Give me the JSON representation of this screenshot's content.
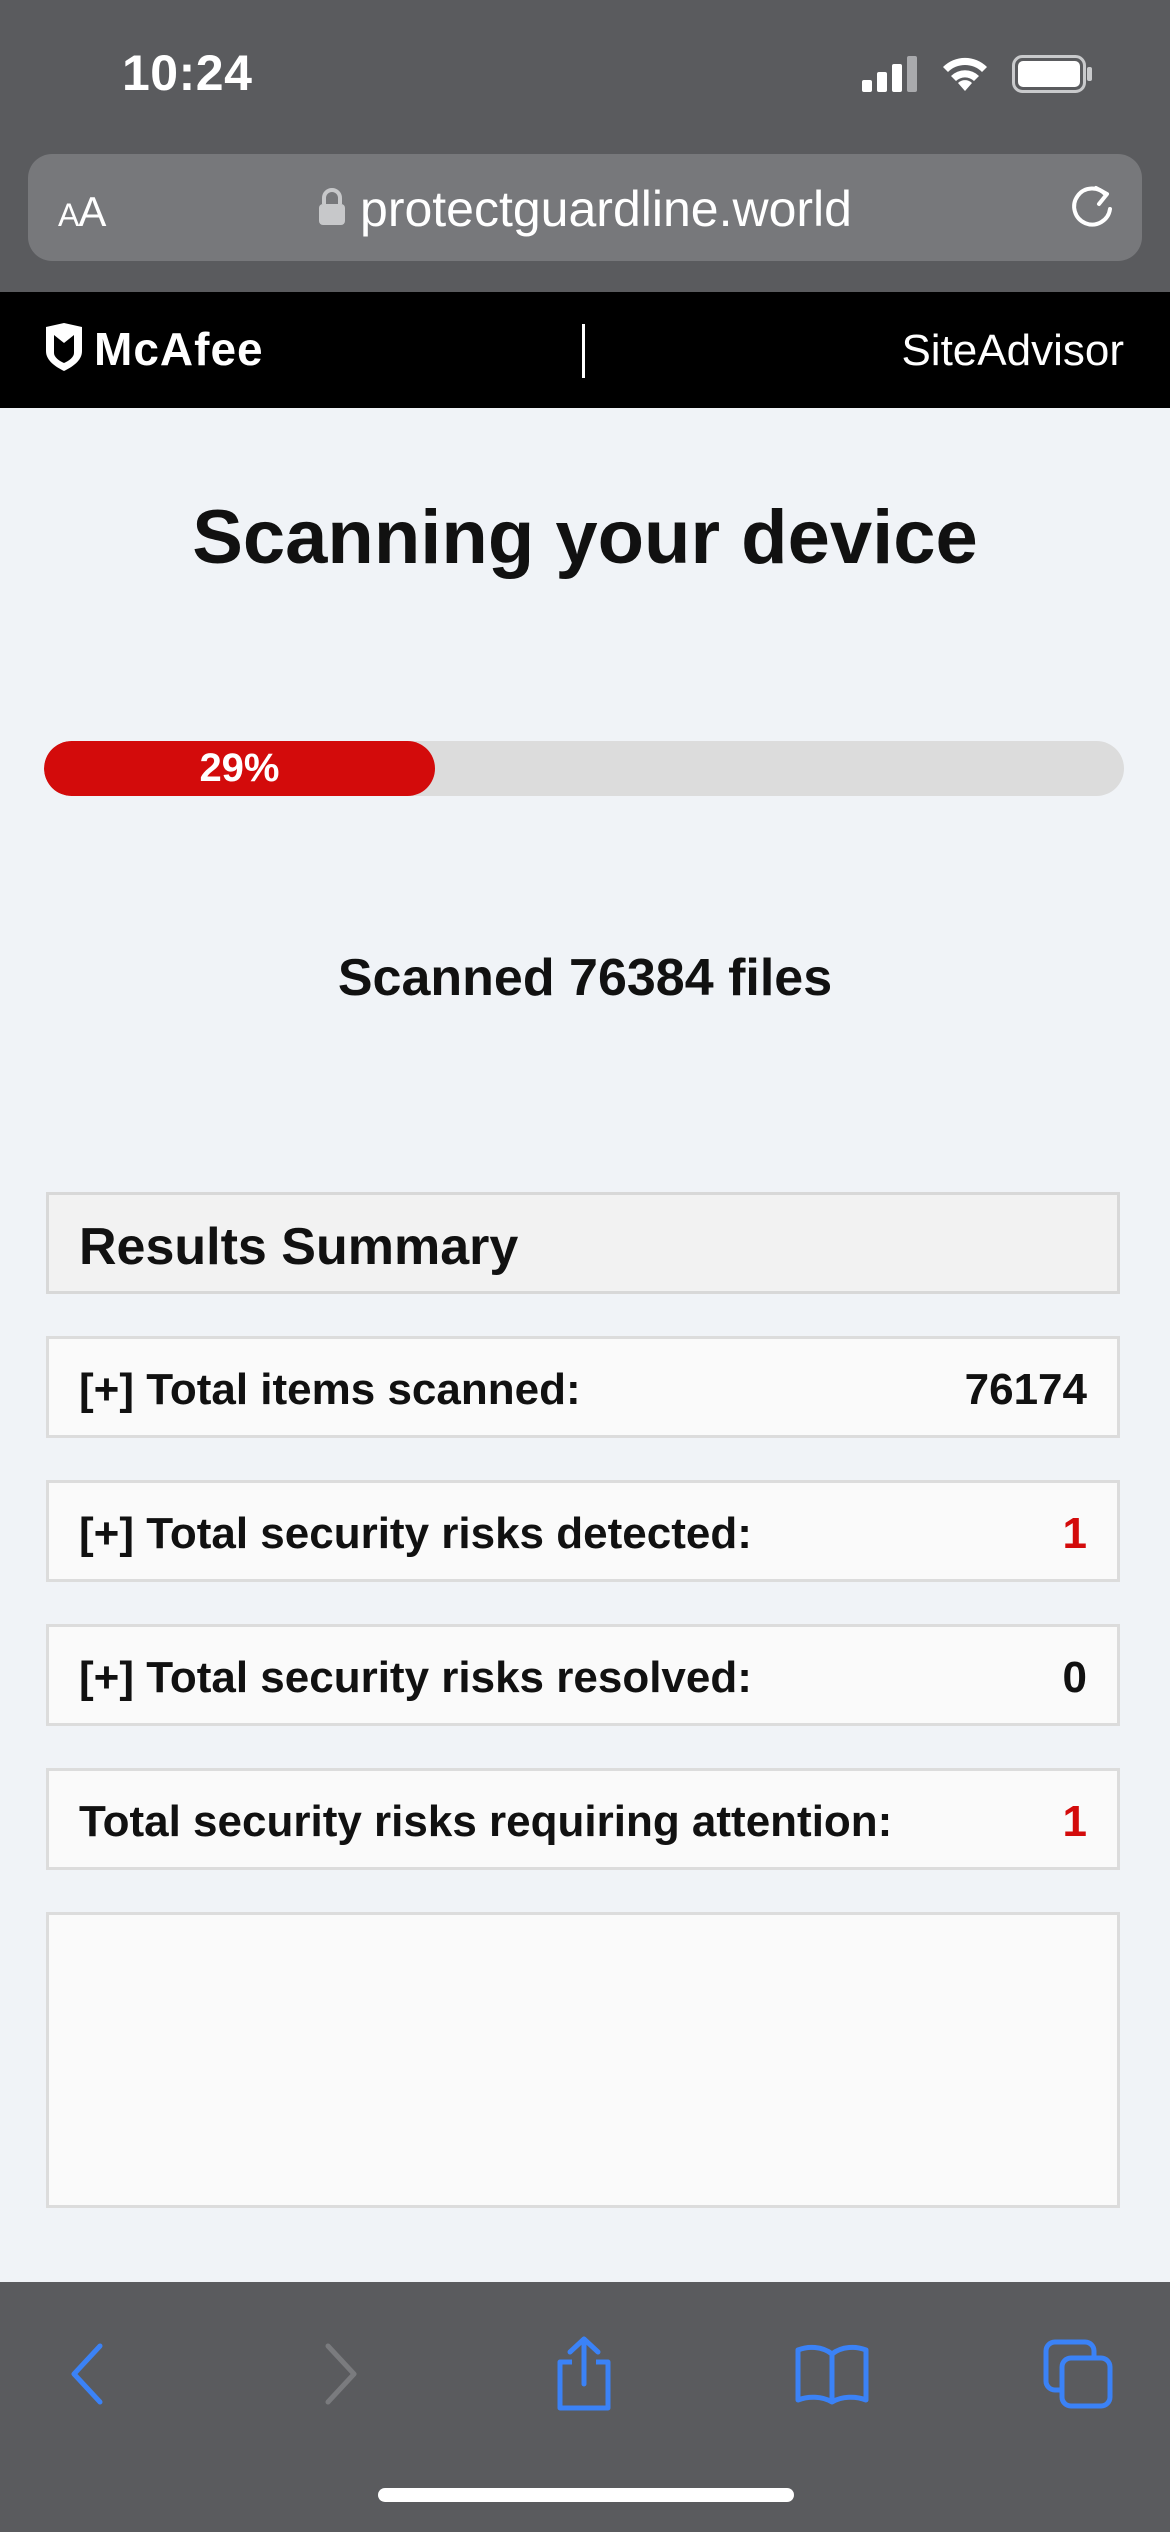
{
  "status_bar": {
    "time": "10:24",
    "icons": [
      "signal-icon",
      "wifi-icon",
      "battery-icon"
    ]
  },
  "browser": {
    "text_size_label_small": "A",
    "text_size_label_large": "A",
    "url": "protectguardline.world",
    "url_icons": [
      "lock-icon",
      "reload-icon"
    ],
    "toolbar_icons": [
      "back-icon",
      "forward-icon",
      "share-icon",
      "bookmarks-icon",
      "tabs-icon"
    ]
  },
  "header": {
    "brand": "McAfee",
    "product": "SiteAdvisor"
  },
  "scan": {
    "title": "Scanning your device",
    "progress_label": "29%",
    "progress_fraction": 0.362,
    "scanned_text": "Scanned 76384 files"
  },
  "results": {
    "title": "Results Summary",
    "rows": [
      {
        "label": "[+] Total items scanned:",
        "value": "76174",
        "highlight": false
      },
      {
        "label": "[+] Total security risks detected:",
        "value": "1",
        "highlight": true
      },
      {
        "label": "[+] Total security risks resolved:",
        "value": "0",
        "highlight": false
      },
      {
        "label": "Total security risks requiring attention:",
        "value": "1",
        "highlight": true
      }
    ]
  },
  "colors": {
    "accent_red": "#d30b0b",
    "browser_chrome": "#5a5b5e",
    "ios_blue": "#3b82f6"
  }
}
